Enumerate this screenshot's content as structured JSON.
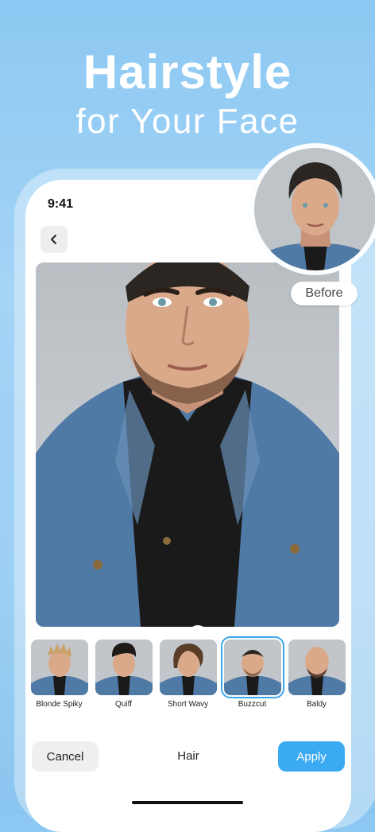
{
  "promo": {
    "title": "Hairstyle",
    "subtitle": "for Your Face"
  },
  "status_bar": {
    "time": "9:41"
  },
  "comparison": {
    "before_label": "Before"
  },
  "pager": {
    "pages": [
      "1",
      "2",
      "3"
    ],
    "active": "1"
  },
  "styles": [
    {
      "label": "Blonde Spiky",
      "hair_color": "#c9a36a",
      "selected": false
    },
    {
      "label": "Quiff",
      "hair_color": "#1e1a17",
      "selected": false
    },
    {
      "label": "Short Wavy",
      "hair_color": "#5a3e27",
      "selected": false
    },
    {
      "label": "Buzzcut",
      "hair_color": "#2b2622",
      "selected": true
    },
    {
      "label": "Baldy",
      "hair_color": "#d9a98a",
      "selected": false
    }
  ],
  "bottom_bar": {
    "cancel_label": "Cancel",
    "title": "Hair",
    "apply_label": "Apply"
  },
  "colors": {
    "accent": "#3aaaf2",
    "selection": "#3aa6ee",
    "denim": "#4f7aa6",
    "skin": "#d9a98a"
  }
}
